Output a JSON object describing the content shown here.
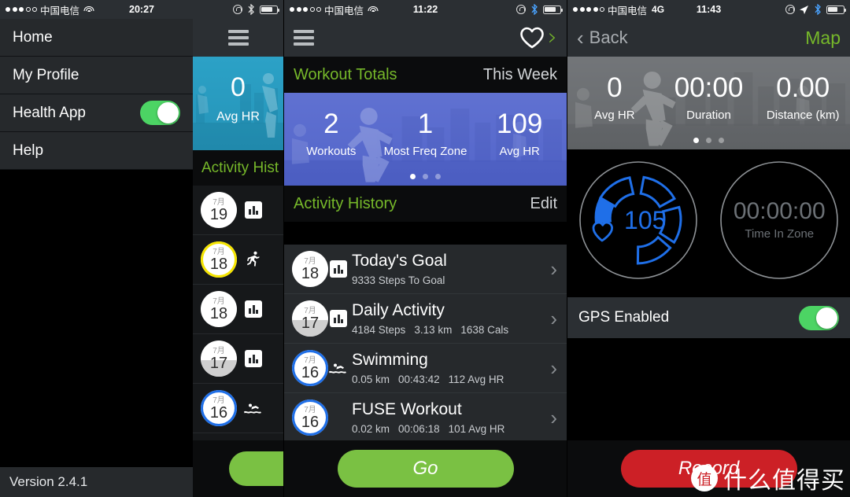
{
  "left": {
    "status": {
      "carrier": "中国电信",
      "signal_filled": 3,
      "signal_total": 5,
      "wifi": true,
      "time": "20:27"
    },
    "menu": [
      {
        "label": "Home",
        "toggle": null
      },
      {
        "label": "My Profile",
        "toggle": null
      },
      {
        "label": "Health App",
        "toggle": "on"
      },
      {
        "label": "Help",
        "toggle": null
      }
    ],
    "version": "Version 2.4.1",
    "peek": {
      "hero": {
        "value": "0",
        "label": "Avg HR"
      },
      "section_title": "Activity Hist",
      "rows": [
        {
          "month": "7月",
          "day": "19",
          "icon": "bar-chart-icon",
          "ring": "none",
          "fill": 0
        },
        {
          "month": "7月",
          "day": "18",
          "icon": "running-icon",
          "ring": "yellow",
          "fill": 0
        },
        {
          "month": "7月",
          "day": "18",
          "icon": "bar-chart-icon",
          "ring": "none",
          "fill": 0
        },
        {
          "month": "7月",
          "day": "17",
          "icon": "bar-chart-icon",
          "ring": "none",
          "fill": 45
        },
        {
          "month": "7月",
          "day": "16",
          "icon": "swimming-icon",
          "ring": "blue",
          "fill": 0
        }
      ]
    }
  },
  "middle": {
    "status": {
      "carrier": "中国电信",
      "signal_filled": 3,
      "signal_total": 5,
      "wifi": true,
      "time": "11:22"
    },
    "nav": {
      "menu_icon": "hamburger-icon",
      "heart_icon": "heart-icon",
      "chevron": "›"
    },
    "totals": {
      "title": "Workout Totals",
      "range": "This Week"
    },
    "hero": {
      "stats": [
        {
          "value": "2",
          "label": "Workouts"
        },
        {
          "value": "1",
          "label": "Most Freq Zone"
        },
        {
          "value": "109",
          "label": "Avg HR"
        }
      ],
      "pages": 3,
      "active_page": 0
    },
    "history": {
      "title": "Activity History",
      "edit": "Edit"
    },
    "rows": [
      {
        "month": "7月",
        "day": "18",
        "ring": "none",
        "fill": 0,
        "icon": "bar-chart-icon",
        "title": "Today's Goal",
        "stats": [
          "9333 Steps To Goal"
        ]
      },
      {
        "month": "7月",
        "day": "17",
        "ring": "none",
        "fill": 45,
        "icon": "bar-chart-icon",
        "title": "Daily Activity",
        "stats": [
          "4184 Steps",
          "3.13 km",
          "1638 Cals"
        ]
      },
      {
        "month": "7月",
        "day": "16",
        "ring": "blue",
        "fill": 0,
        "icon": "swimming-icon",
        "title": "Swimming",
        "stats": [
          "0.05 km",
          "00:43:42",
          "112 Avg HR"
        ]
      },
      {
        "month": "7月",
        "day": "16",
        "ring": "blue",
        "fill": 0,
        "icon": "none",
        "title": "FUSE Workout",
        "stats": [
          "0.02 km",
          "00:06:18",
          "101 Avg HR"
        ]
      }
    ],
    "go_button": "Go"
  },
  "right": {
    "status": {
      "carrier": "中国电信",
      "signal_filled": 4,
      "signal_total": 5,
      "network": "4G",
      "time": "11:43"
    },
    "nav": {
      "back": "Back",
      "map": "Map"
    },
    "hero": {
      "stats": [
        {
          "value": "0",
          "label": "Avg HR"
        },
        {
          "value": "00:00",
          "label": "Duration"
        },
        {
          "value": "0.00",
          "label": "Distance (km)"
        }
      ],
      "pages": 3,
      "active_page": 0
    },
    "gauge_hr": {
      "value": "105",
      "icon": "heart-icon",
      "segments": 5,
      "filled_fraction": 0.14,
      "color": "#1f6fe8"
    },
    "gauge_time": {
      "value": "00:00:00",
      "label": "Time In Zone",
      "color": "#555a5f"
    },
    "gps": {
      "label": "GPS Enabled",
      "toggle": "on"
    },
    "record_button": "Record",
    "watermark": {
      "badge": "值",
      "text": "什么值得买"
    }
  },
  "colors": {
    "accent_green": "#76b82a",
    "button_green": "#7ac143",
    "toggle_green": "#4cd464",
    "record_red": "#cc2026",
    "hero_blue": "#5e6fd0",
    "gauge_blue": "#1f6fe8",
    "peek_teal": "#2a9fc4"
  }
}
